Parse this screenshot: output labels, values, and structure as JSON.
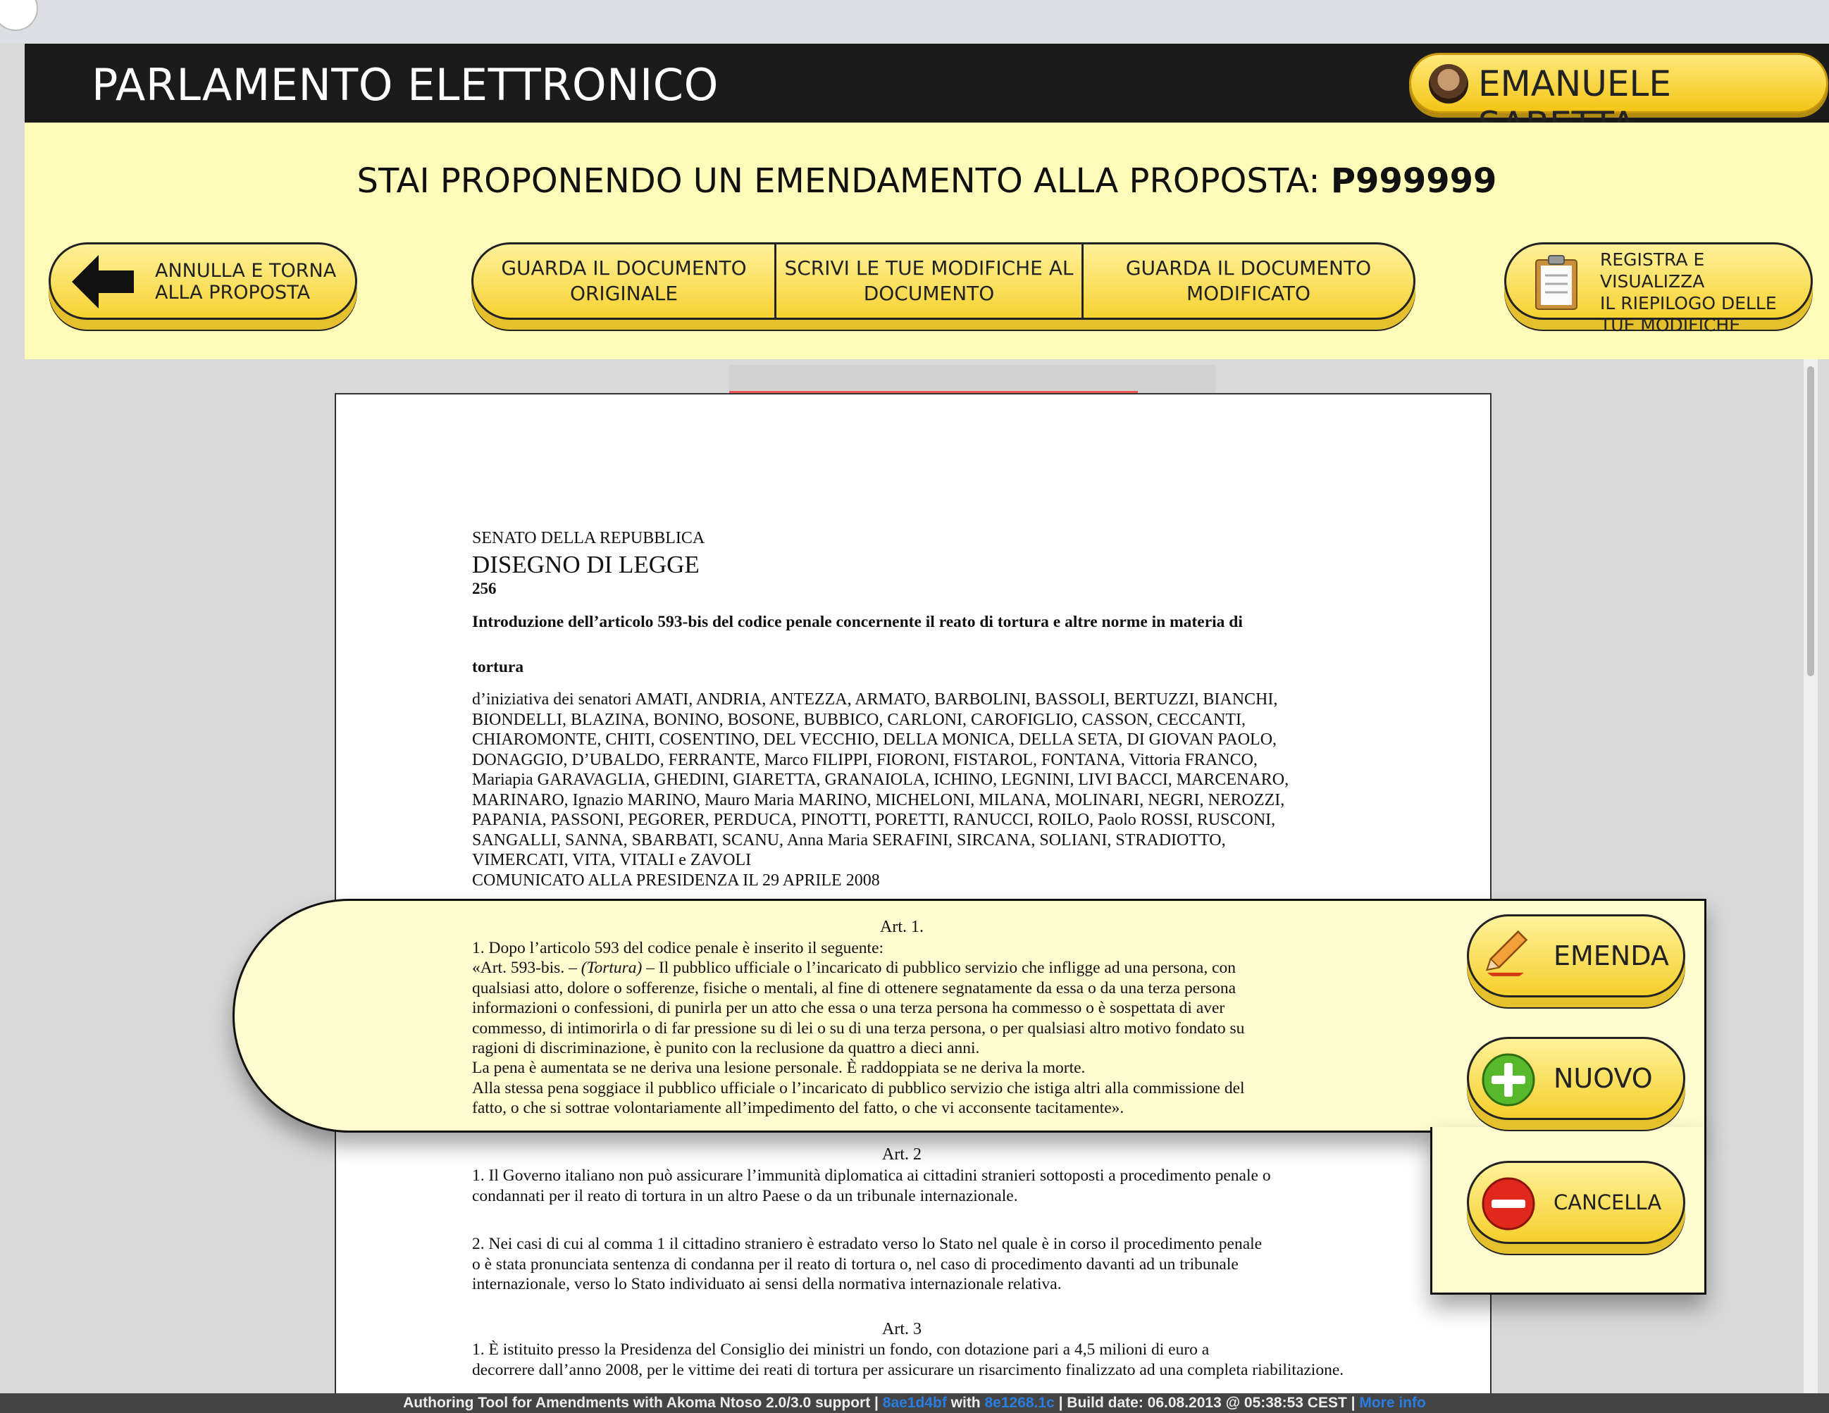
{
  "app": {
    "title": "PARLAMENTO ELETTRONICO",
    "user_name": "EMANUELE SABETTA"
  },
  "header": {
    "proposal_prefix": "STAI PROPONENDO UN EMENDAMENTO ALLA PROPOSTA:",
    "proposal_code": "P999999"
  },
  "toolbar": {
    "back_line1": "ANNULLA E TORNA",
    "back_line2": "ALLA PROPOSTA",
    "tabs": [
      {
        "line1": "GUARDA IL DOCUMENTO",
        "line2": "ORIGINALE"
      },
      {
        "line1": "SCRIVI LE TUE MODIFICHE AL",
        "line2": "DOCUMENTO"
      },
      {
        "line1": "GUARDA IL DOCUMENTO",
        "line2": "MODIFICATO"
      }
    ],
    "register_line1": "REGISTRA E VISUALIZZA",
    "register_line2": "IL RIEPILOGO DELLE",
    "register_line3": "TUE MODIFICHE"
  },
  "document": {
    "senate": "SENATO DELLA REPUBBLICA",
    "kind": "DISEGNO DI LEGGE",
    "number": "256",
    "title_line1": "Introduzione dell’articolo 593-bis del codice penale concernente il reato di tortura e altre norme in materia di",
    "title_line2": "tortura",
    "sponsors": [
      "d’iniziativa dei senatori AMATI, ANDRIA, ANTEZZA, ARMATO, BARBOLINI, BASSOLI, BERTUZZI, BIANCHI,",
      "BIONDELLI, BLAZINA, BONINO, BOSONE, BUBBICO, CARLONI, CAROFIGLIO, CASSON, CECCANTI,",
      "CHIAROMONTE, CHITI, COSENTINO, DEL VECCHIO, DELLA MONICA, DELLA SETA, DI GIOVAN PAOLO,",
      "DONAGGIO, D’UBALDO, FERRANTE, Marco FILIPPI, FIORONI, FISTAROL, FONTANA, Vittoria FRANCO,",
      "Mariapia GARAVAGLIA, GHEDINI, GIARETTA, GRANAIOLA, ICHINO, LEGNINI, LIVI BACCI, MARCENARO,",
      "MARINARO, Ignazio MARINO, Mauro Maria MARINO, MICHELONI, MILANA, MOLINARI, NEGRI, NEROZZI,",
      "PAPANIA, PASSONI, PEGORER, PERDUCA, PINOTTI, PORETTI, RANUCCI, ROILO, Paolo ROSSI, RUSCONI,",
      "SANGALLI, SANNA, SBARBATI, SCANU, Anna Maria SERAFINI, SIRCANA, SOLIANI, STRADIOTTO,",
      "VIMERCATI, VITA, VITALI e ZAVOLI"
    ],
    "communicated": "COMUNICATO ALLA PRESIDENZA IL 29 APRILE 2008",
    "art1": {
      "heading": "Art. 1.",
      "lines": [
        "1. Dopo l’articolo 593 del codice penale è inserito il seguente:",
        "qualsiasi atto, dolore o sofferenze, fisiche o mentali, al fine di ottenere segnatamente da essa o da una terza persona",
        "informazioni o confessioni, di punirla per un atto che essa o una terza persona ha commesso o è sospettata di aver",
        "commesso, di intimorirla o di far pressione su di lei o su di una terza persona, o per qualsiasi altro motivo fondato su",
        "ragioni di discriminazione, è punito con la reclusione da quattro a dieci anni.",
        "La pena è aumentata se ne deriva una lesione personale. È raddoppiata se ne deriva la morte.",
        "Alla stessa pena soggiace il pubblico ufficiale o l’incaricato di pubblico servizio che istiga altri alla commissione del",
        "fatto, o che si sottrae volontariamente all’impedimento del fatto, o che vi acconsente tacitamente»."
      ],
      "line2_a": "«Art. 593-bis. – ",
      "line2_b": "(Tortura)",
      "line2_c": " – Il pubblico ufficiale o l’incaricato di pubblico servizio che infligge ad una persona, con"
    },
    "art2": {
      "heading": "Art. 2",
      "p1_line1": "1. Il Governo italiano non può assicurare l’immunità diplomatica ai cittadini stranieri sottoposti a procedimento penale o",
      "p1_line2": "condannati per il reato di tortura in un altro Paese o da un tribunale internazionale.",
      "p2_line1": "2. Nei casi di cui al comma 1 il cittadino straniero è estradato verso lo Stato nel quale è in corso il procedimento penale",
      "p2_line2": "o è stata pronunciata sentenza di condanna per il reato di tortura o, nel caso di procedimento davanti ad un tribunale",
      "p2_line3": "internazionale, verso lo Stato individuato ai sensi della normativa internazionale relativa."
    },
    "art3": {
      "heading": "Art. 3",
      "line1": "1. È istituito presso la Presidenza del Consiglio dei ministri un fondo, con dotazione pari a 4,5 milioni di euro a",
      "line2": "decorrere dall’anno 2008, per le vittime dei reati di tortura per assicurare un risarcimento finalizzato ad una completa riabilitazione."
    }
  },
  "actions": {
    "emend": "EMENDA",
    "new": "NUOVO",
    "delete": "CANCELLA"
  },
  "footer": {
    "part1": "Authoring Tool for Amendments with Akoma Ntoso 2.0/3.0 support | ",
    "link1": "8ae1d4bf",
    "part2": " with ",
    "link2": "8e1268.1c",
    "part3": " | Build date: 06.08.2013 @ 05:38:53 CEST | ",
    "link3": "More info"
  },
  "colors": {
    "yellow_bg": "#fffbb9",
    "button_yellow": "#f7d233",
    "titlebar": "#1b1b1b",
    "highlight_bg": "#fffbd0"
  }
}
